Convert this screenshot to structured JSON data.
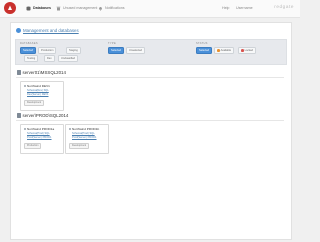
{
  "nav": {
    "items": [
      {
        "label": "Databases",
        "icon": "database-icon",
        "active": true
      },
      {
        "label": "Unused management",
        "icon": "trash-icon",
        "active": false
      },
      {
        "label": "Notifications",
        "icon": "bell-icon",
        "active": false
      }
    ],
    "help": "Help",
    "user": "Username",
    "brand": "redgate"
  },
  "management_link": "Management and databases",
  "filters": {
    "groups": [
      {
        "label": "DATABASES",
        "chips": [
          "Selected",
          "Production",
          "Staging",
          "Testing",
          "Dev",
          "Unclassified"
        ]
      },
      {
        "label": "TYPE",
        "chips": [
          "Selected",
          "Unselected"
        ]
      },
      {
        "label": "STATUS",
        "chips": [
          "Selected",
          "Available",
          "Locked"
        ]
      }
    ]
  },
  "servers": [
    {
      "name": "server01\\MSSQL2014",
      "databases": [
        {
          "name": "Northwind DEV1",
          "links": [
            "Schema(Dev) SQL",
            "Dev(Server) DEV1"
          ],
          "action": "Development"
        }
      ]
    },
    {
      "name": "server\\PROD\\SQL2014",
      "databases": [
        {
          "name": "Northwind PROD1a",
          "links": [
            "Schema(Prod) SQL",
            "Prod(Server) PROD1"
          ],
          "action": "Production"
        },
        {
          "name": "Northwind PROD1b",
          "links": [
            "Schema(Prod) SQL",
            "Prod(Server) PROD1"
          ],
          "action": "Development"
        }
      ]
    }
  ],
  "colors": {
    "accent": "#4a90d9",
    "brand": "#c9302c",
    "link": "#4a7fb0"
  }
}
